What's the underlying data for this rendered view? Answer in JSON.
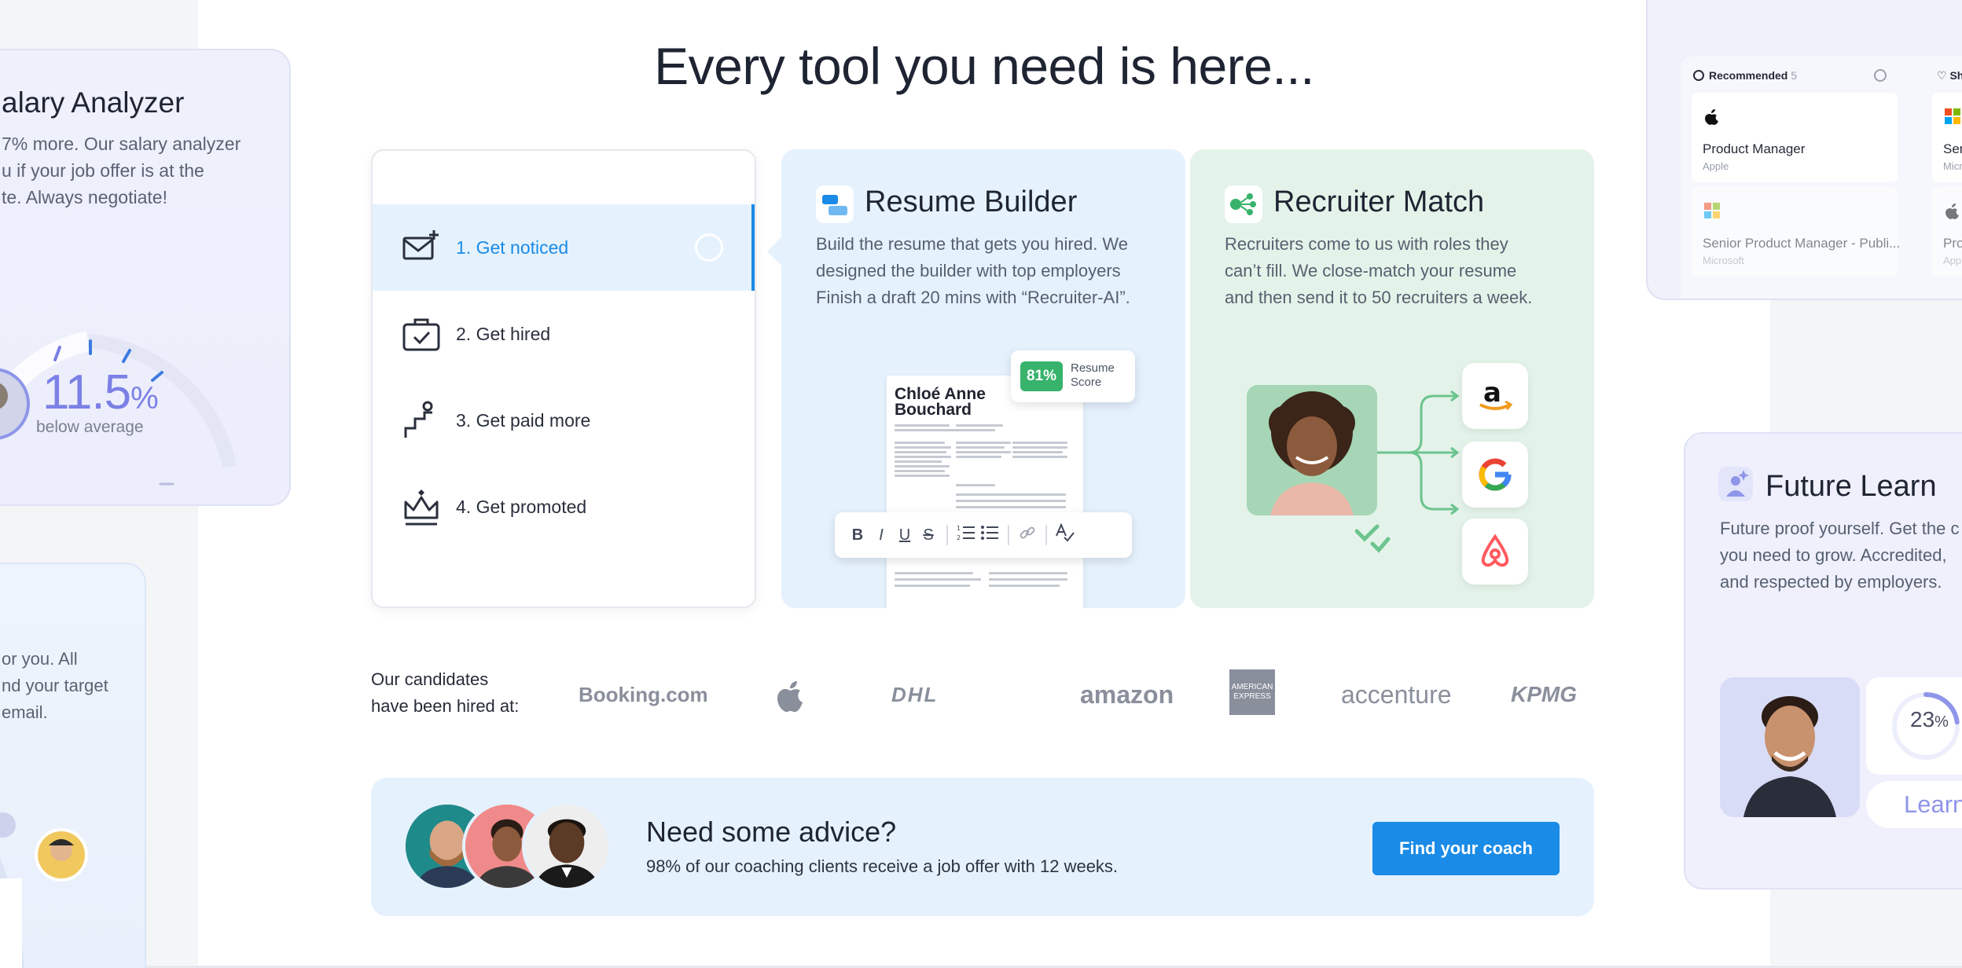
{
  "title": "Every tool you need is here...",
  "salary_card": {
    "title": "alary Analyzer",
    "desc_lines": [
      "7% more. Our salary analyzer",
      "u if your job offer is at the",
      "te. Always negotiate!"
    ],
    "value": "11.5",
    "unit": "%",
    "caption": "below average"
  },
  "email_card": {
    "desc_lines": [
      "or you. All",
      "nd your target",
      "email."
    ]
  },
  "steps": [
    {
      "label": "1. Get noticed",
      "icon": "envelope-plus-icon",
      "active": true
    },
    {
      "label": "2. Get hired",
      "icon": "briefcase-check-icon",
      "active": false
    },
    {
      "label": "3. Get paid more",
      "icon": "person-stairs-icon",
      "active": false
    },
    {
      "label": "4. Get promoted",
      "icon": "crown-icon",
      "active": false
    }
  ],
  "resume_builder": {
    "title": "Resume Builder",
    "desc_lines": [
      "Build the resume that gets you hired. We",
      "designed the builder with top employers",
      "Finish a draft 20 mins with “Recruiter-AI”."
    ],
    "resume_name_lines": [
      "Chloé Anne",
      "Bouchard"
    ],
    "score_value": "81%",
    "score_label": "Resume Score",
    "toolbar": [
      "B",
      "I",
      "U",
      "S"
    ]
  },
  "recruiter_match": {
    "title": "Recruiter Match",
    "desc_lines": [
      "Recruiters come to us with roles they",
      "can’t fill. We close-match your resume",
      "and then send it to 50 recruiters a week."
    ],
    "companies": [
      "amazon-logo",
      "google-logo",
      "airbnb-logo"
    ]
  },
  "hired": {
    "label_lines": [
      "Our candidates",
      "have been hired at:"
    ],
    "logos": [
      "Booking.com",
      "apple-logo",
      "DHL",
      "amazon",
      "AMERICAN EXPRESS",
      "accenture",
      "KPMG"
    ]
  },
  "advice": {
    "title": "Need some advice?",
    "desc": "98% of our coaching clients receive a job offer with 12 weeks.",
    "button": "Find your coach"
  },
  "jobs_card": {
    "tab_label": "Recommended",
    "tab_count": "5",
    "side_tab": "Sh",
    "jobs": [
      {
        "title": "Product Manager",
        "company": "Apple",
        "logo": "apple-logo"
      },
      {
        "title": "Senior Product Manager - Publi...",
        "company": "Microsoft",
        "logo": "microsoft-logo"
      }
    ],
    "side_jobs": [
      {
        "title": "Senio",
        "company": "Micro"
      },
      {
        "title": "Produ",
        "company": "Apple"
      }
    ]
  },
  "learn_card": {
    "title": "Future Learn",
    "desc_lines": [
      "Future proof yourself. Get the c",
      "you need to grow. Accredited,",
      "and respected by employers."
    ],
    "progress": "23",
    "progress_unit": "%",
    "progress_fraction": 0.23,
    "button": "Learn"
  },
  "colors": {
    "accent": "#1a8be6",
    "resume_bg": "#e5f1fd",
    "recruiter_bg": "#e4f3e9",
    "score_green": "#37b36b",
    "salary_purple": "#7b80e6"
  }
}
